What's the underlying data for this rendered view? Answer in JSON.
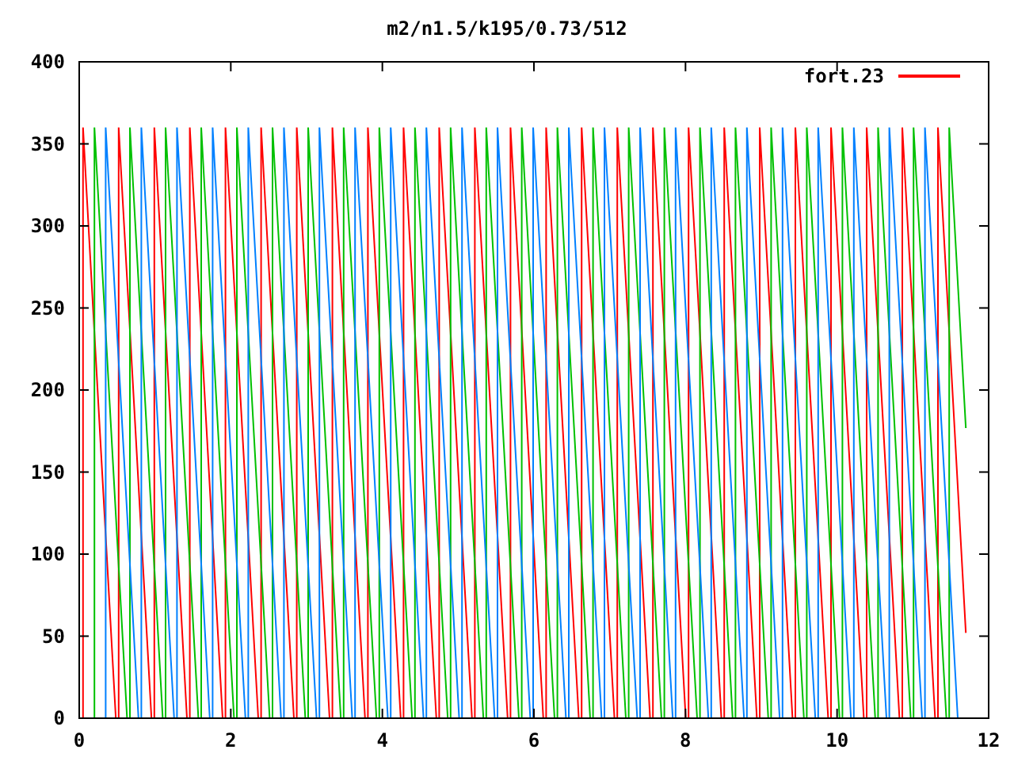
{
  "title": "m2/n1.5/k195/0.73/512",
  "legend": {
    "label": "fort.23",
    "color": "#ff0000"
  },
  "x_axis": {
    "ticks": [
      "0",
      "2",
      "4",
      "6",
      "8",
      "10",
      "12"
    ]
  },
  "y_axis": {
    "ticks": [
      "400",
      "350",
      "300",
      "250",
      "200",
      "150",
      "100",
      "50",
      "0"
    ]
  }
}
